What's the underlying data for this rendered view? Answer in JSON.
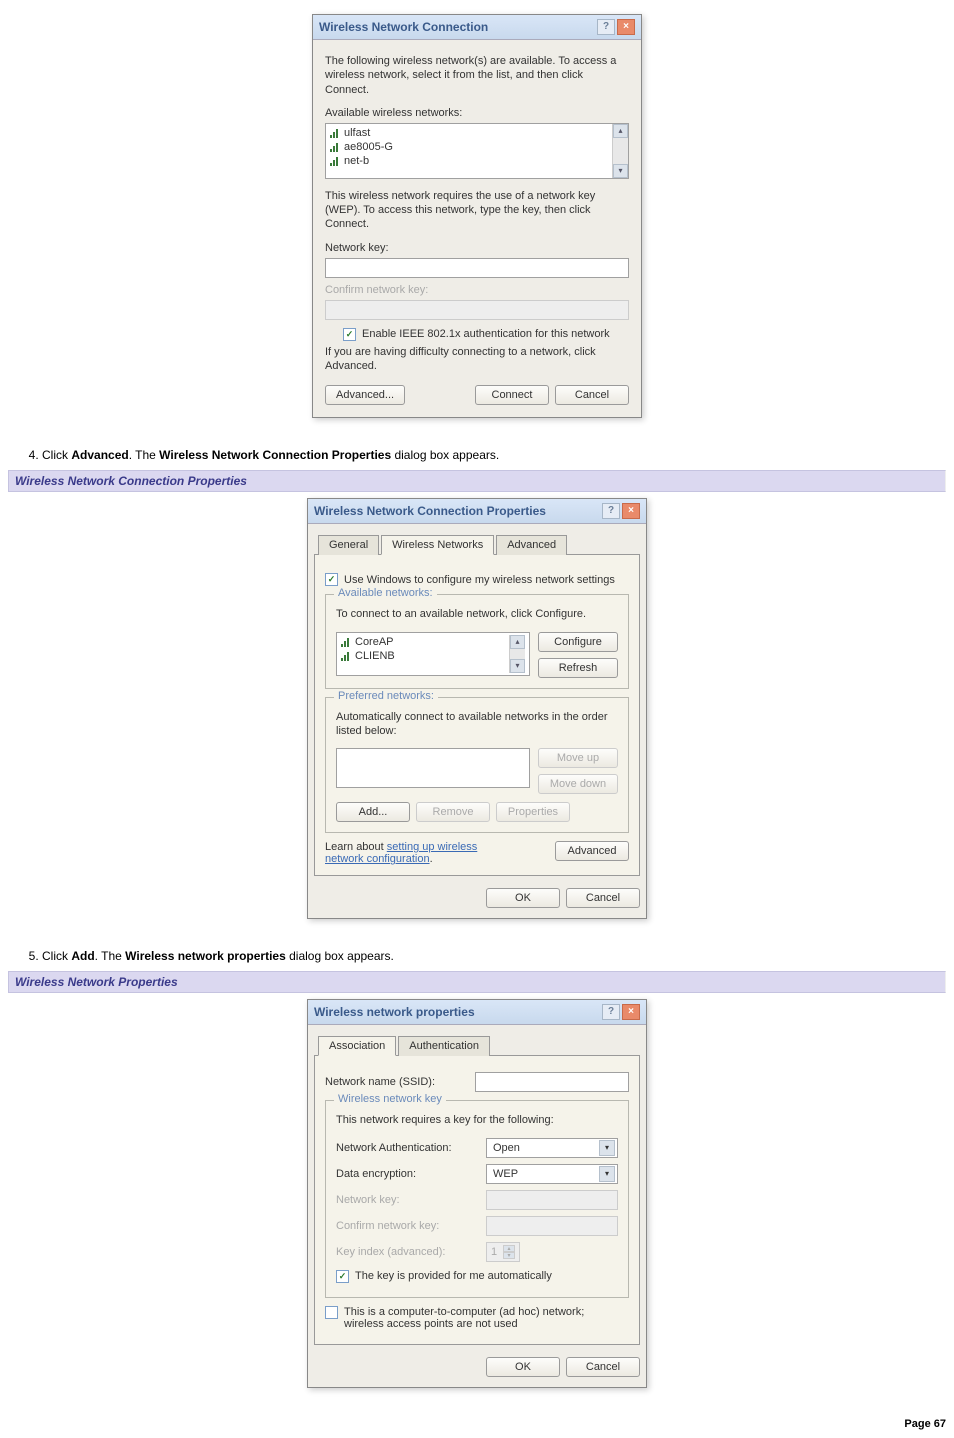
{
  "dlg1": {
    "title": "Wireless Network Connection",
    "intro": "The following wireless network(s) are available. To access a wireless network, select it from the list, and then click Connect.",
    "available_label": "Available wireless networks:",
    "items": [
      "ulfast",
      "ae8005-G",
      "net-b"
    ],
    "wep_text": "This wireless network requires the use of a network key (WEP). To access this network, type the key, then click Connect.",
    "netkey_label": "Network key:",
    "confirm_label": "Confirm network key:",
    "enable_8021x": "Enable IEEE 802.1x authentication for this network",
    "difficulty_text": "If you are having difficulty connecting to a network, click Advanced.",
    "btn_advanced": "Advanced...",
    "btn_connect": "Connect",
    "btn_cancel": "Cancel"
  },
  "step4": {
    "text_a": "Click ",
    "bold_a": "Advanced",
    "text_b": ". The ",
    "bold_b": "Wireless Network Connection Properties",
    "text_c": " dialog box appears."
  },
  "sec1": "Wireless Network Connection Properties",
  "dlg2": {
    "title": "Wireless Network Connection Properties",
    "tabs": [
      "General",
      "Wireless Networks",
      "Advanced"
    ],
    "use_windows": "Use Windows to configure my wireless network settings",
    "available_legend": "Available networks:",
    "available_text": "To connect to an available network, click Configure.",
    "available_items": [
      "CoreAP",
      "CLIENB"
    ],
    "btn_configure": "Configure",
    "btn_refresh": "Refresh",
    "preferred_legend": "Preferred networks:",
    "preferred_text": "Automatically connect to available networks in the order listed below:",
    "btn_moveup": "Move up",
    "btn_movedown": "Move down",
    "btn_add": "Add...",
    "btn_remove": "Remove",
    "btn_props": "Properties",
    "learn_a": "Learn about ",
    "learn_link": "setting up wireless network configuration",
    "learn_b": ".",
    "btn_advanced": "Advanced",
    "btn_ok": "OK",
    "btn_cancel": "Cancel"
  },
  "step5": {
    "text_a": "Click ",
    "bold_a": "Add",
    "text_b": ". The ",
    "bold_b": "Wireless network properties",
    "text_c": " dialog box appears."
  },
  "sec2": "Wireless Network Properties",
  "dlg3": {
    "title": "Wireless network properties",
    "tabs": [
      "Association",
      "Authentication"
    ],
    "ssid_label": "Network name (SSID):",
    "wkey_legend": "Wireless network key",
    "wkey_text": "This network requires a key for the following:",
    "auth_label": "Network Authentication:",
    "auth_value": "Open",
    "enc_label": "Data encryption:",
    "enc_value": "WEP",
    "netkey_label": "Network key:",
    "confirm_label": "Confirm network key:",
    "keyindex_label": "Key index (advanced):",
    "keyindex_value": "1",
    "provided_auto": "The key is provided for me automatically",
    "adhoc_text": "This is a computer-to-computer (ad hoc) network; wireless access points are not used",
    "btn_ok": "OK",
    "btn_cancel": "Cancel"
  },
  "footer": "Page 67"
}
